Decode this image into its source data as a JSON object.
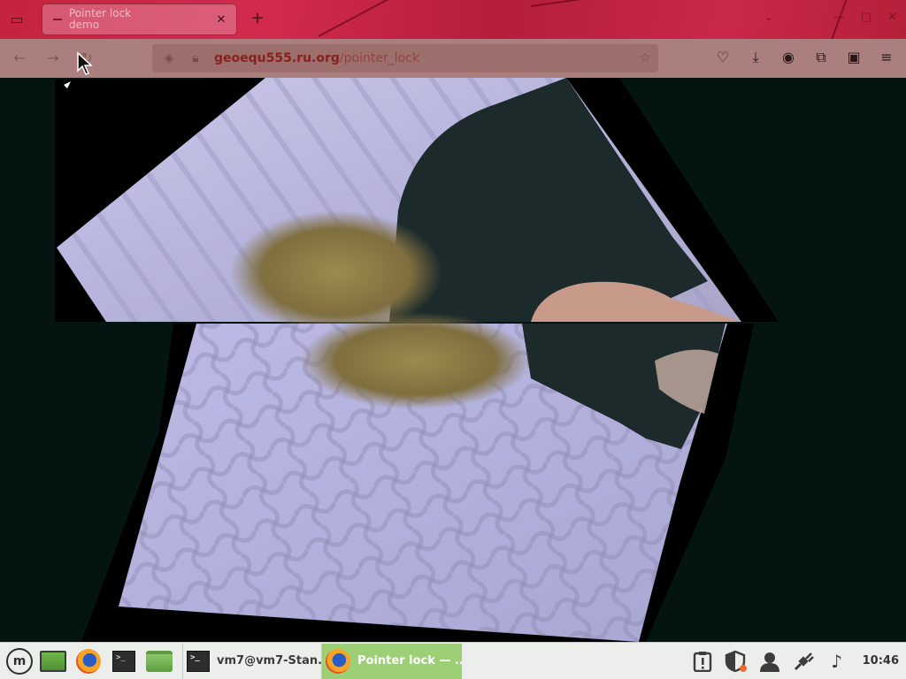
{
  "browser": {
    "tab": {
      "title_line1": "Pointer lock",
      "title_line2": "demo"
    },
    "url": {
      "host": "geoequ555.ru.org",
      "path": "/pointer_lock"
    }
  },
  "taskbar": {
    "tasks": [
      {
        "label": "vm7@vm7-Stan..."
      },
      {
        "label": "Pointer lock — ..."
      }
    ],
    "clock": "10:46"
  },
  "icons": {
    "mint_menu": "linux-mint-icon",
    "desktop": "show-desktop-icon",
    "firefox": "firefox-icon",
    "terminal": "terminal-icon",
    "files": "folder-icon"
  }
}
